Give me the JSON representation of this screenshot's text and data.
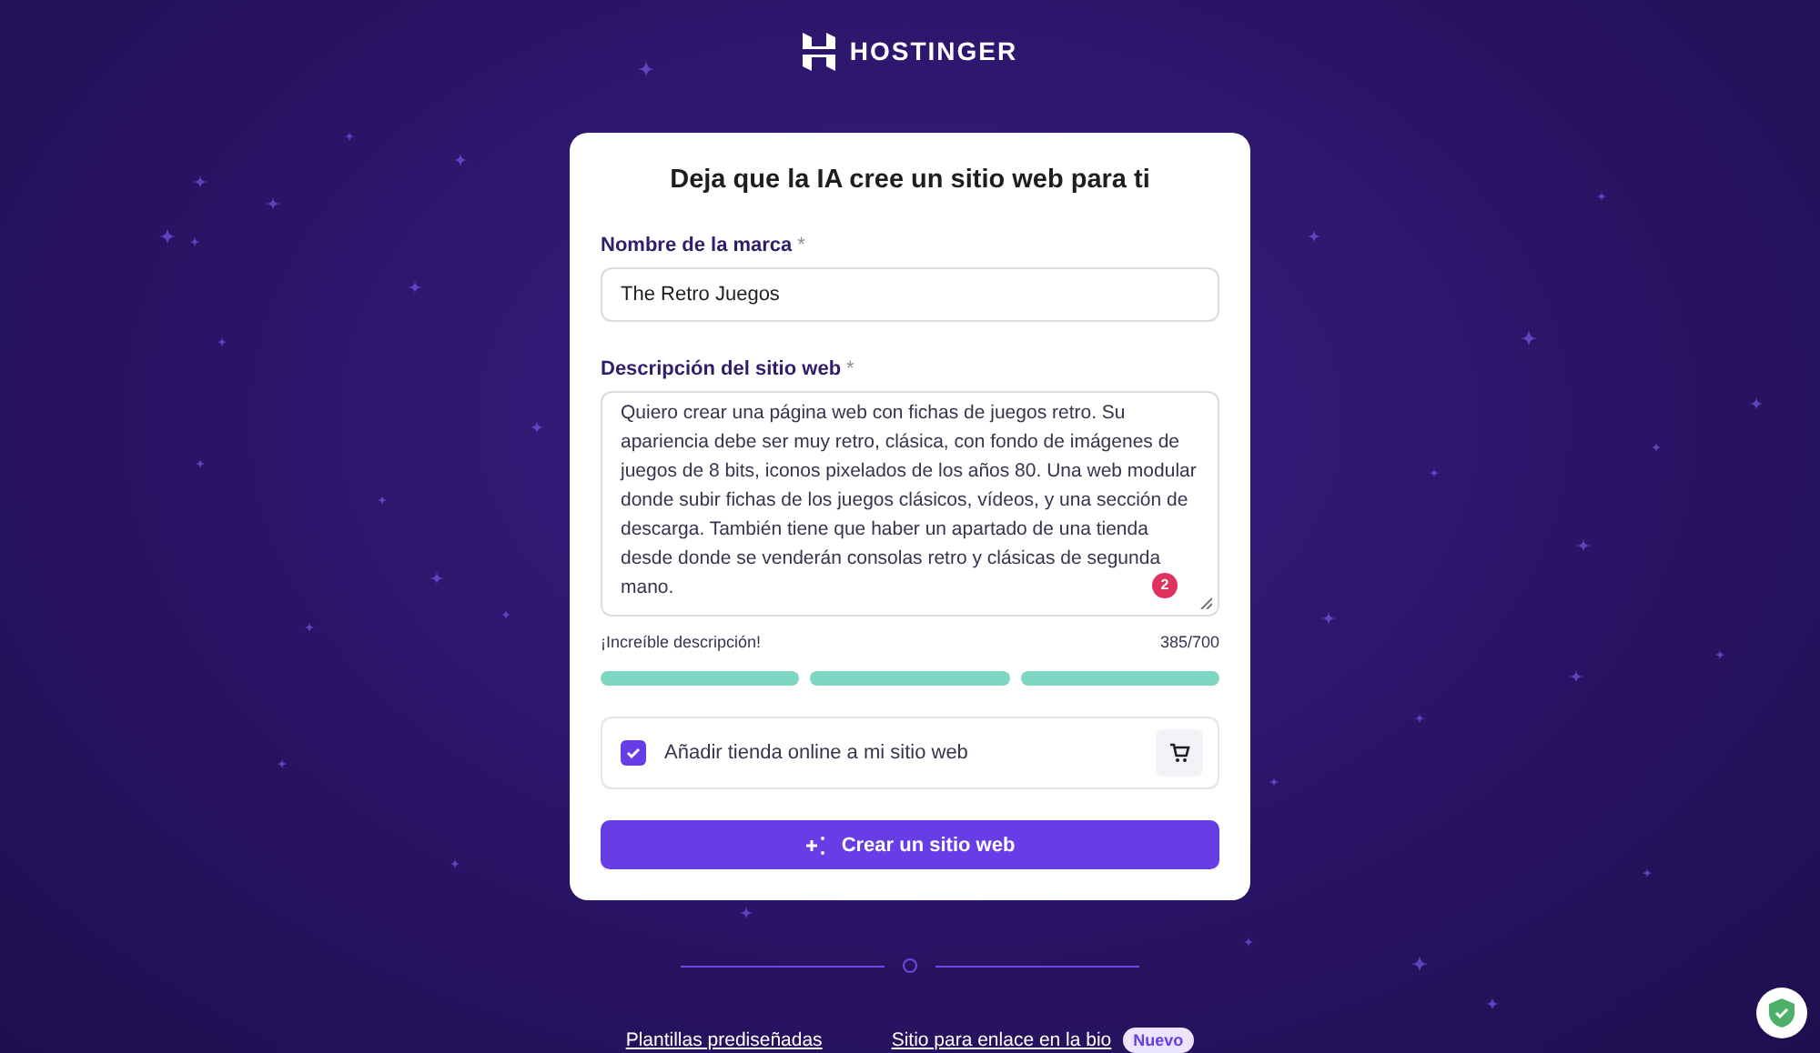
{
  "logo": {
    "name": "HOSTINGER"
  },
  "card": {
    "title": "Deja que la IA cree un sitio web para ti",
    "brand_field": {
      "label": "Nombre de la marca",
      "required": "*",
      "value": "The Retro Juegos"
    },
    "description_field": {
      "label": "Descripción del sitio web",
      "required": "*",
      "value": "Quiero crear una página web con fichas de juegos retro. Su apariencia debe ser muy retro, clásica, con fondo de imágenes de juegos de 8 bits, iconos pixelados de los años 80. Una web modular donde subir fichas de los juegos clásicos, vídeos, y una sección de descarga. También tiene que haber un apartado de una tienda desde donde se venderán consolas retro y clásicas de segunda mano.",
      "issue_count": "2"
    },
    "feedback": "¡Increíble descripción!",
    "counter": "385/700",
    "strength": [
      {
        "filled": true
      },
      {
        "filled": true
      },
      {
        "filled": true
      }
    ],
    "store_option": {
      "label": "Añadir tienda online a mi sitio web",
      "checked": true
    },
    "submit": {
      "label": "Crear un sitio web"
    }
  },
  "footer_links": [
    {
      "label": "Plantillas prediseñadas"
    },
    {
      "label": "Sitio para enlace en la bio",
      "badge": "Nuevo"
    }
  ]
}
